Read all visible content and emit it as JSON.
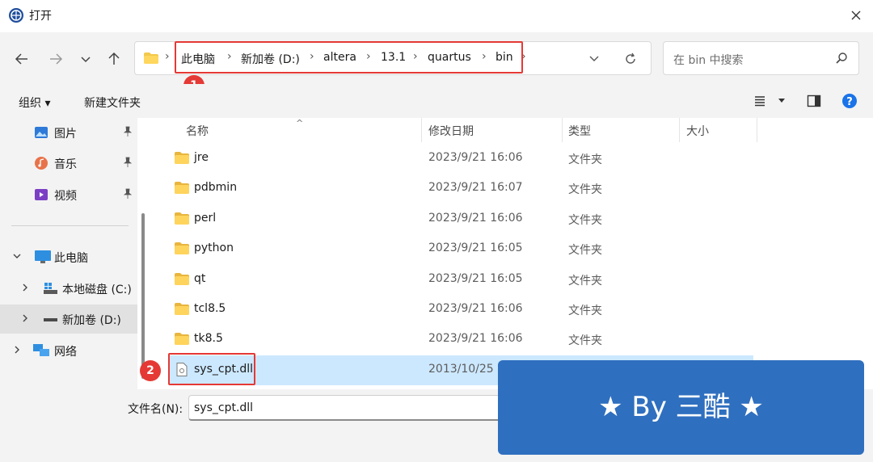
{
  "window": {
    "title": "打开"
  },
  "nav": {
    "back": "back",
    "forward": "forward",
    "recent": "recent",
    "up": "up"
  },
  "address": {
    "crumbs": [
      "此电脑",
      "新加卷 (D:)",
      "altera",
      "13.1",
      "quartus",
      "bin"
    ],
    "badge": "1"
  },
  "search": {
    "placeholder": "在 bin 中搜索"
  },
  "toolbar": {
    "organize": "组织 ▾",
    "new_folder": "新建文件夹"
  },
  "sidebar": {
    "pinned": [
      {
        "label": "图片",
        "icon": "pictures-icon"
      },
      {
        "label": "音乐",
        "icon": "music-icon"
      },
      {
        "label": "视频",
        "icon": "videos-icon"
      }
    ],
    "this_pc": "此电脑",
    "drives": [
      "本地磁盘 (C:)",
      "新加卷 (D:)"
    ],
    "network": "网络"
  },
  "columns": {
    "name": "名称",
    "date": "修改日期",
    "type": "类型",
    "size": "大小"
  },
  "files": [
    {
      "name": "jre",
      "date": "2023/9/21 16:06",
      "type": "文件夹"
    },
    {
      "name": "pdbmin",
      "date": "2023/9/21 16:07",
      "type": "文件夹"
    },
    {
      "name": "perl",
      "date": "2023/9/21 16:06",
      "type": "文件夹"
    },
    {
      "name": "python",
      "date": "2023/9/21 16:05",
      "type": "文件夹"
    },
    {
      "name": "qt",
      "date": "2023/9/21 16:05",
      "type": "文件夹"
    },
    {
      "name": "tcl8.5",
      "date": "2023/9/21 16:06",
      "type": "文件夹"
    },
    {
      "name": "tk8.5",
      "date": "2023/9/21 16:06",
      "type": "文件夹"
    },
    {
      "name": "sys_cpt.dll",
      "date": "2013/10/25",
      "type": ""
    }
  ],
  "file_badge": "2",
  "filename": {
    "label": "文件名(N):",
    "value": "sys_cpt.dll"
  },
  "watermark": "★ By 三酷 ★",
  "colors": {
    "accent": "#0067c0",
    "highlight": "#e53935",
    "selected": "#cce8ff",
    "watermark": "#2f6fbf"
  }
}
